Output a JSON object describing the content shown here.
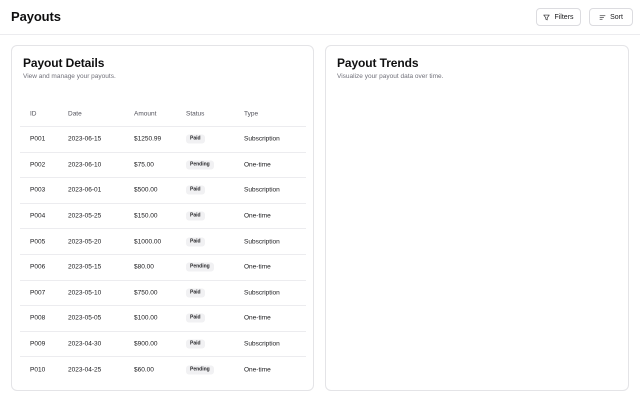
{
  "header": {
    "title": "Payouts",
    "filters_label": "Filters",
    "sort_label": "Sort"
  },
  "details": {
    "title": "Payout Details",
    "description": "View and manage your payouts.",
    "columns": {
      "id": "ID",
      "date": "Date",
      "amount": "Amount",
      "status": "Status",
      "type": "Type"
    },
    "rows": [
      {
        "id": "P001",
        "date": "2023-06-15",
        "amount": "$1250.99",
        "status": "Paid",
        "type": "Subscription"
      },
      {
        "id": "P002",
        "date": "2023-06-10",
        "amount": "$75.00",
        "status": "Pending",
        "type": "One-time"
      },
      {
        "id": "P003",
        "date": "2023-06-01",
        "amount": "$500.00",
        "status": "Paid",
        "type": "Subscription"
      },
      {
        "id": "P004",
        "date": "2023-05-25",
        "amount": "$150.00",
        "status": "Paid",
        "type": "One-time"
      },
      {
        "id": "P005",
        "date": "2023-05-20",
        "amount": "$1000.00",
        "status": "Paid",
        "type": "Subscription"
      },
      {
        "id": "P006",
        "date": "2023-05-15",
        "amount": "$80.00",
        "status": "Pending",
        "type": "One-time"
      },
      {
        "id": "P007",
        "date": "2023-05-10",
        "amount": "$750.00",
        "status": "Paid",
        "type": "Subscription"
      },
      {
        "id": "P008",
        "date": "2023-05-05",
        "amount": "$100.00",
        "status": "Paid",
        "type": "One-time"
      },
      {
        "id": "P009",
        "date": "2023-04-30",
        "amount": "$900.00",
        "status": "Paid",
        "type": "Subscription"
      },
      {
        "id": "P010",
        "date": "2023-04-25",
        "amount": "$60.00",
        "status": "Pending",
        "type": "One-time"
      }
    ]
  },
  "trends": {
    "title": "Payout Trends",
    "description": "Visualize your payout data over time."
  },
  "icons": {
    "filters": "filter-icon",
    "sort": "sort-list-icon"
  }
}
